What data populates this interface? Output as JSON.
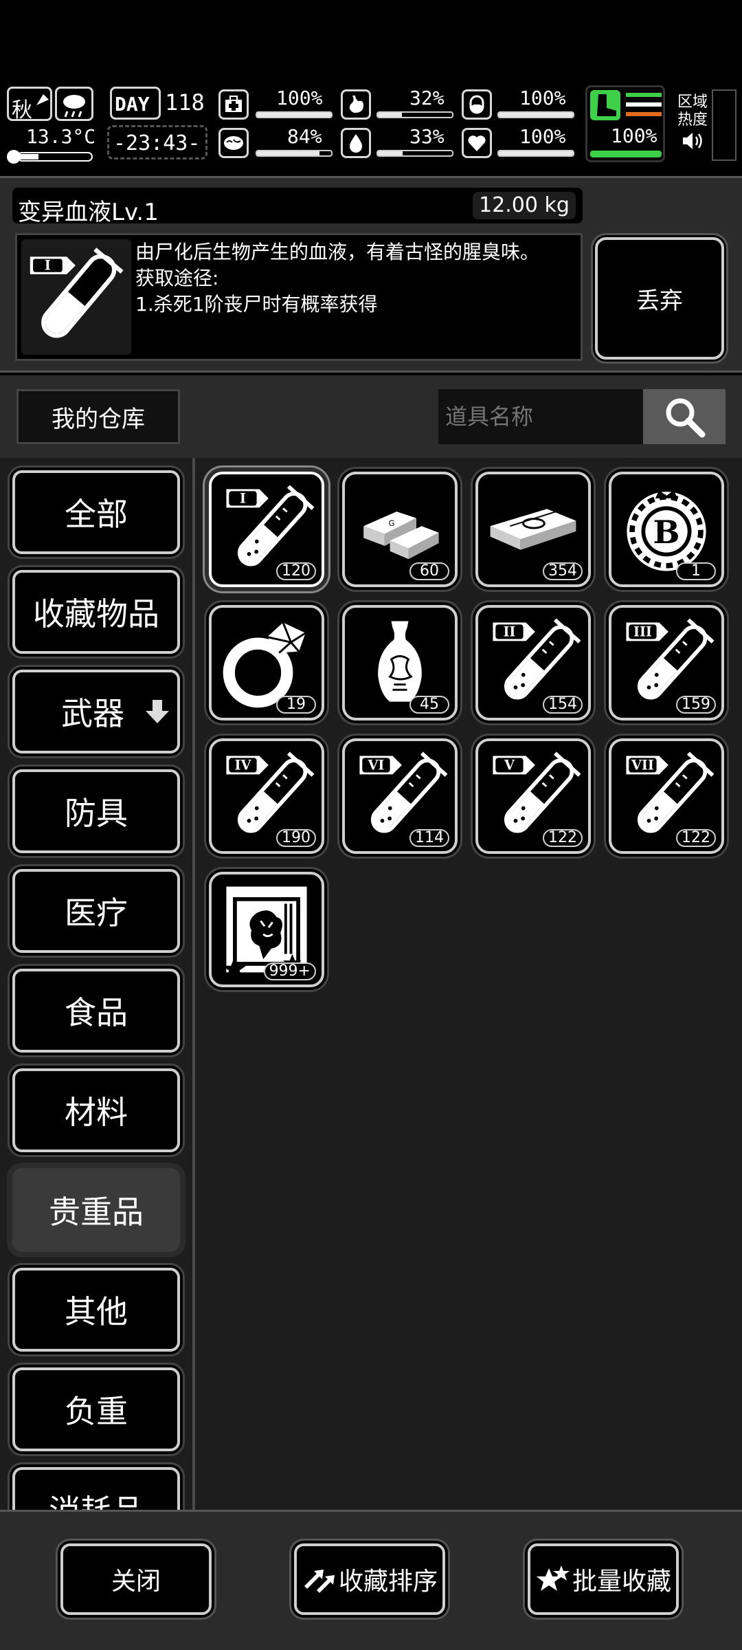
{
  "status_bar": {
    "season": "秋",
    "temperature": "13.3°C",
    "day_label": "DAY",
    "day_number": "118",
    "time": "-23:43-",
    "stats": [
      {
        "icon": "medkit-icon",
        "value": "100%",
        "fraction": 1.0
      },
      {
        "icon": "stomach-icon",
        "value": "32%",
        "fraction": 0.32
      },
      {
        "icon": "pill-icon",
        "value": "100%",
        "fraction": 1.0
      },
      {
        "icon": "brain-icon",
        "value": "84%",
        "fraction": 0.84
      },
      {
        "icon": "water-drop-icon",
        "value": "33%",
        "fraction": 0.33
      },
      {
        "icon": "heart-icon",
        "value": "100%",
        "fraction": 1.0
      }
    ],
    "stamina_value": "100%",
    "stamina_fraction": 1.0,
    "region_heat_label": "区域\n热度"
  },
  "detail": {
    "item_name": "变异血液Lv.1",
    "weight": "12.00 kg",
    "description": "由尸化后生物产生的血液，有着古怪的腥臭味。\n获取途径:\n1.杀死1阶丧尸时有概率获得",
    "discard_label": "丢弃",
    "icon_roman": "I"
  },
  "warehouse": {
    "title": "我的仓库",
    "search_placeholder": "道具名称"
  },
  "categories": [
    {
      "label": "全部",
      "active": false
    },
    {
      "label": "收藏物品",
      "active": false
    },
    {
      "label": "武器",
      "active": false,
      "arrow": true
    },
    {
      "label": "防具",
      "active": false
    },
    {
      "label": "医疗",
      "active": false
    },
    {
      "label": "食品",
      "active": false
    },
    {
      "label": "材料",
      "active": false
    },
    {
      "label": "贵重品",
      "active": true
    },
    {
      "label": "其他",
      "active": false
    },
    {
      "label": "负重",
      "active": false
    },
    {
      "label": "消耗品",
      "active": false
    }
  ],
  "items": [
    {
      "icon": "blood-vial-icon",
      "roman": "I",
      "count": "120",
      "selected": true
    },
    {
      "icon": "gold-bars-icon",
      "count": "60"
    },
    {
      "icon": "cash-stack-icon",
      "count": "354"
    },
    {
      "icon": "bitcoin-coin-icon",
      "count": "1"
    },
    {
      "icon": "diamond-ring-icon",
      "count": "19"
    },
    {
      "icon": "vase-icon",
      "count": "45"
    },
    {
      "icon": "blood-vial-icon",
      "roman": "II",
      "count": "154"
    },
    {
      "icon": "blood-vial-icon",
      "roman": "III",
      "count": "159"
    },
    {
      "icon": "blood-vial-icon",
      "roman": "IV",
      "count": "190"
    },
    {
      "icon": "blood-vial-icon",
      "roman": "VI",
      "count": "114"
    },
    {
      "icon": "blood-vial-icon",
      "roman": "V",
      "count": "122"
    },
    {
      "icon": "blood-vial-icon",
      "roman": "VII",
      "count": "122"
    },
    {
      "icon": "collectible-card-icon",
      "count": "999+"
    }
  ],
  "bottom": {
    "close_label": "关闭",
    "sort_label": "收藏排序",
    "batch_label": "批量收藏"
  }
}
